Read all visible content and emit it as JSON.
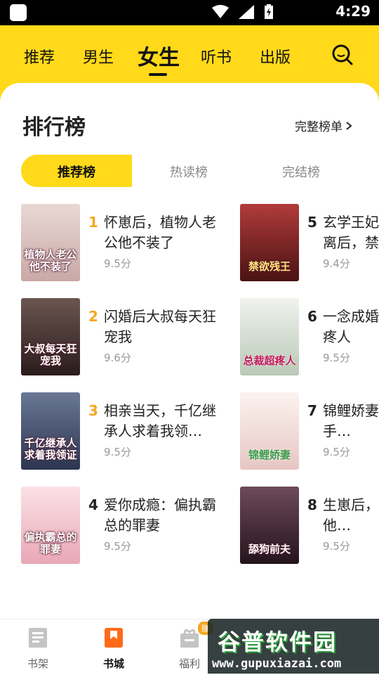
{
  "status_bar": {
    "time": "4:29"
  },
  "header": {
    "tabs": [
      {
        "label": "推荐"
      },
      {
        "label": "男生"
      },
      {
        "label": "女生"
      },
      {
        "label": "听书"
      },
      {
        "label": "出版"
      }
    ],
    "active_tab": "女生"
  },
  "ranking": {
    "title": "排行榜",
    "full_list_label": "完整榜单",
    "subtabs": [
      {
        "label": "推荐榜"
      },
      {
        "label": "热读榜"
      },
      {
        "label": "完结榜"
      }
    ],
    "books": [
      {
        "rank": "1",
        "title": "怀崽后，植物人老公他不装了",
        "score": "9.5分",
        "cover_text": "植物人老公他不装了",
        "cover_color": "#e7c9c6"
      },
      {
        "rank": "2",
        "title": "闪婚后大叔每天狂宠我",
        "score": "9.6分",
        "cover_text": "大叔每天狂宠我",
        "cover_color": "#3a2a2a"
      },
      {
        "rank": "3",
        "title": "相亲当天，千亿继承人求着我领…",
        "score": "9.5分",
        "cover_text": "千亿继承人求着我领证",
        "cover_color": "#3b4a6e"
      },
      {
        "rank": "4",
        "title": "爱你成瘾：偏执霸总的罪妻",
        "score": "9.5分",
        "cover_text": "偏执霸总的罪妻",
        "cover_color": "#f4cdd6"
      },
      {
        "rank": "5",
        "title": "玄学王妃：王爷和离后，禁欲残王…",
        "score": "9.4分",
        "cover_text": "禁欲残王",
        "cover_color": "#7a1f24"
      },
      {
        "rank": "6",
        "title": "一念成婚：总裁超疼人",
        "score": "9.5分",
        "cover_text": "总裁超疼人",
        "cover_color": "#dbe4dc"
      },
      {
        "rank": "7",
        "title": "锦鲤娇妻：王宠妻手…",
        "score": "9.5分",
        "cover_text": "锦鲤娇妻",
        "cover_color": "#f1e5e5"
      },
      {
        "rank": "8",
        "title": "生崽后，夫总说他…",
        "score": "9.5分",
        "cover_text": "舔狗前夫",
        "cover_color": "#3a2230"
      }
    ]
  },
  "bottom_nav": {
    "items": [
      {
        "label": "书架"
      },
      {
        "label": "书城"
      },
      {
        "label": "福利"
      }
    ],
    "badge": "赚"
  },
  "watermark": {
    "cn": "谷普软件园",
    "en": "www.gupuxiazai.com"
  },
  "colors": {
    "accent": "#ffd91a",
    "rank_top": "#f5a623",
    "nav_active": "#ff6a1a"
  }
}
